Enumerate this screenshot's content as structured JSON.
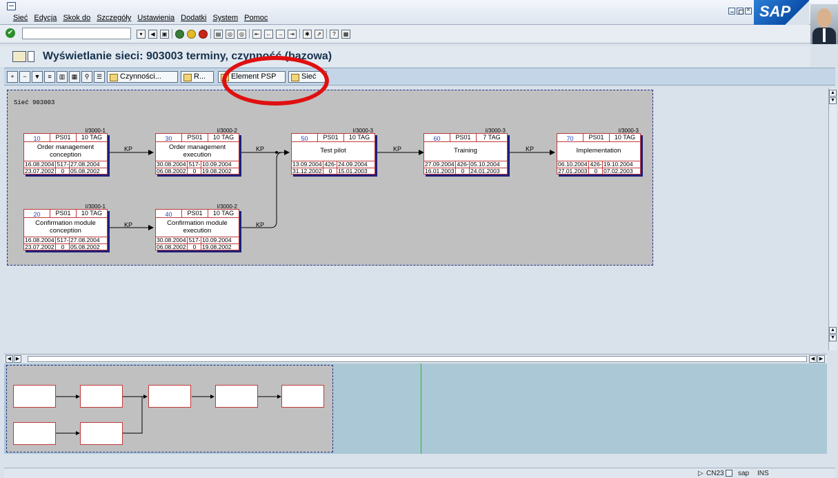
{
  "menu": {
    "items": [
      "Sieć",
      "Edycja",
      "Skok do",
      "Szczegóły",
      "Ustawienia",
      "Dodatki",
      "System",
      "Pomoc"
    ]
  },
  "brand": {
    "logo_text": "SAP"
  },
  "header": {
    "title": "Wyświetlanie sieci: 903003 terminy, czynność (bazowa)"
  },
  "app_toolbar": {
    "activities_label": "Czynności...",
    "r_label": "R...",
    "wbs_label": "Element PSP",
    "network_label": "Sieć"
  },
  "network": {
    "label": "Sieć 903003",
    "link_label": "KP",
    "nodes": [
      {
        "id": "10",
        "plant": "PS01",
        "duration": "10 TAG",
        "wc": "I/3000-1",
        "name": [
          "Order management",
          "conception"
        ],
        "row1": [
          "16.08.2004",
          "517-",
          "27.08.2004"
        ],
        "row2": [
          "23.07.2002",
          "0",
          "05.08.2002"
        ]
      },
      {
        "id": "30",
        "plant": "PS01",
        "duration": "10 TAG",
        "wc": "I/3000-2",
        "name": [
          "Order management",
          "execution"
        ],
        "row1": [
          "30.08.2004",
          "517-",
          "10.09.2004"
        ],
        "row2": [
          "06.08.2002",
          "0",
          "19.08.2002"
        ]
      },
      {
        "id": "50",
        "plant": "PS01",
        "duration": "10 TAG",
        "wc": "I/3000-3",
        "name": [
          "Test pilot",
          ""
        ],
        "row1": [
          "13.09.2004",
          "426-",
          "24.09.2004"
        ],
        "row2": [
          "31.12.2002",
          "0",
          "15.01.2003"
        ]
      },
      {
        "id": "60",
        "plant": "PS01",
        "duration": "7 TAG",
        "wc": "I/3000-3",
        "name": [
          "Training",
          ""
        ],
        "row1": [
          "27.09.2004",
          "426-",
          "05.10.2004"
        ],
        "row2": [
          "16.01.2003",
          "0",
          "24.01.2003"
        ]
      },
      {
        "id": "70",
        "plant": "PS01",
        "duration": "10 TAG",
        "wc": "I/3000-3",
        "name": [
          "Implementation",
          ""
        ],
        "row1": [
          "06.10.2004",
          "426-",
          "19.10.2004"
        ],
        "row2": [
          "27.01.2003",
          "0",
          "07.02.2003"
        ]
      },
      {
        "id": "20",
        "plant": "PS01",
        "duration": "10 TAG",
        "wc": "I/3000-1",
        "name": [
          "Confirmation module",
          "conception"
        ],
        "row1": [
          "16.08.2004",
          "517-",
          "27.08.2004"
        ],
        "row2": [
          "23.07.2002",
          "0",
          "05.08.2002"
        ]
      },
      {
        "id": "40",
        "plant": "PS01",
        "duration": "10 TAG",
        "wc": "I/3000-2",
        "name": [
          "Confirmation module",
          "execution"
        ],
        "row1": [
          "30.08.2004",
          "517-",
          "10.09.2004"
        ],
        "row2": [
          "06.08.2002",
          "0",
          "19.08.2002"
        ]
      }
    ]
  },
  "status": {
    "transaction": "CN23",
    "system": "sap",
    "mode": "INS"
  }
}
